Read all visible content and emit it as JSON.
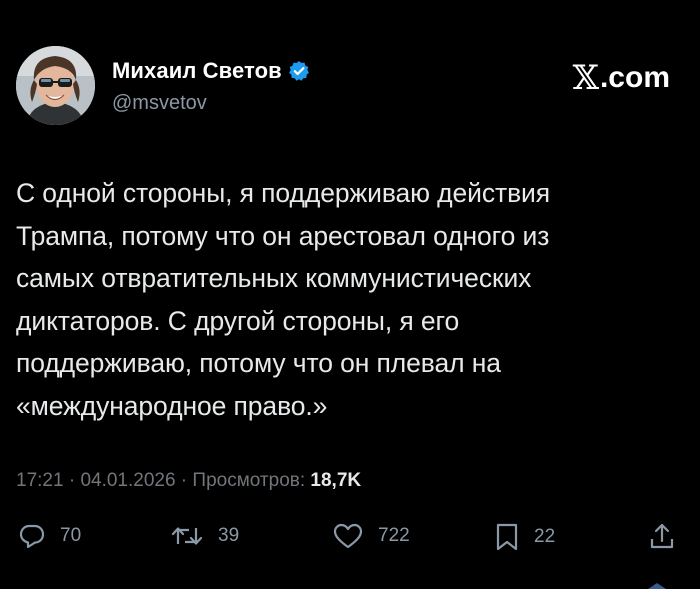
{
  "user": {
    "display_name": "Михаил Светов",
    "handle": "@msvetov",
    "verified": true,
    "avatar_icon": "avatar-photo"
  },
  "site_label": {
    "x": "𝕏",
    "suffix": ".com"
  },
  "tweet": {
    "text": "С одной стороны, я поддерживаю действия\nТрампа, потому что он арестовал одного из\nсамых отвратительных коммунистических\nдиктаторов. С другой стороны, я его\nподдерживаю, потому что он плевал на\n«международное право.»"
  },
  "meta": {
    "time": "17:21",
    "sep1": " · ",
    "date": "04.01.2026",
    "sep2": " · ",
    "views_label": "Просмотров: ",
    "views_count": "18,7K"
  },
  "actions": {
    "reply": {
      "icon": "reply-icon",
      "count": "70"
    },
    "repost": {
      "icon": "repost-icon",
      "count": "39"
    },
    "like": {
      "icon": "heart-icon",
      "count": "722"
    },
    "bookmark": {
      "icon": "bookmark-icon",
      "count": "22"
    },
    "share": {
      "icon": "share-icon"
    }
  },
  "colors": {
    "background": "#000000",
    "text_primary": "#e7e9ea",
    "text_secondary": "#71767b",
    "verified_blue": "#1d9bf0"
  }
}
